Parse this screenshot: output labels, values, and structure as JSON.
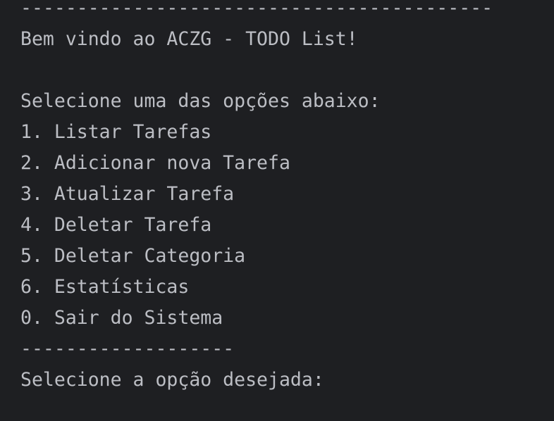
{
  "console": {
    "separator_top": "------------------------------------------",
    "welcome": "Bem vindo ao ACZG - TODO List!",
    "prompt_header": "Selecione uma das opções abaixo:",
    "options": [
      "1. Listar Tarefas",
      "2. Adicionar nova Tarefa",
      "3. Atualizar Tarefa",
      "4. Deletar Tarefa",
      "5. Deletar Categoria",
      "6. Estatísticas",
      "0. Sair do Sistema"
    ],
    "separator_bottom": "-------------------",
    "input_prompt": "Selecione a opção desejada:"
  },
  "colors": {
    "background": "#1e1f22",
    "text": "#bcbec4"
  }
}
